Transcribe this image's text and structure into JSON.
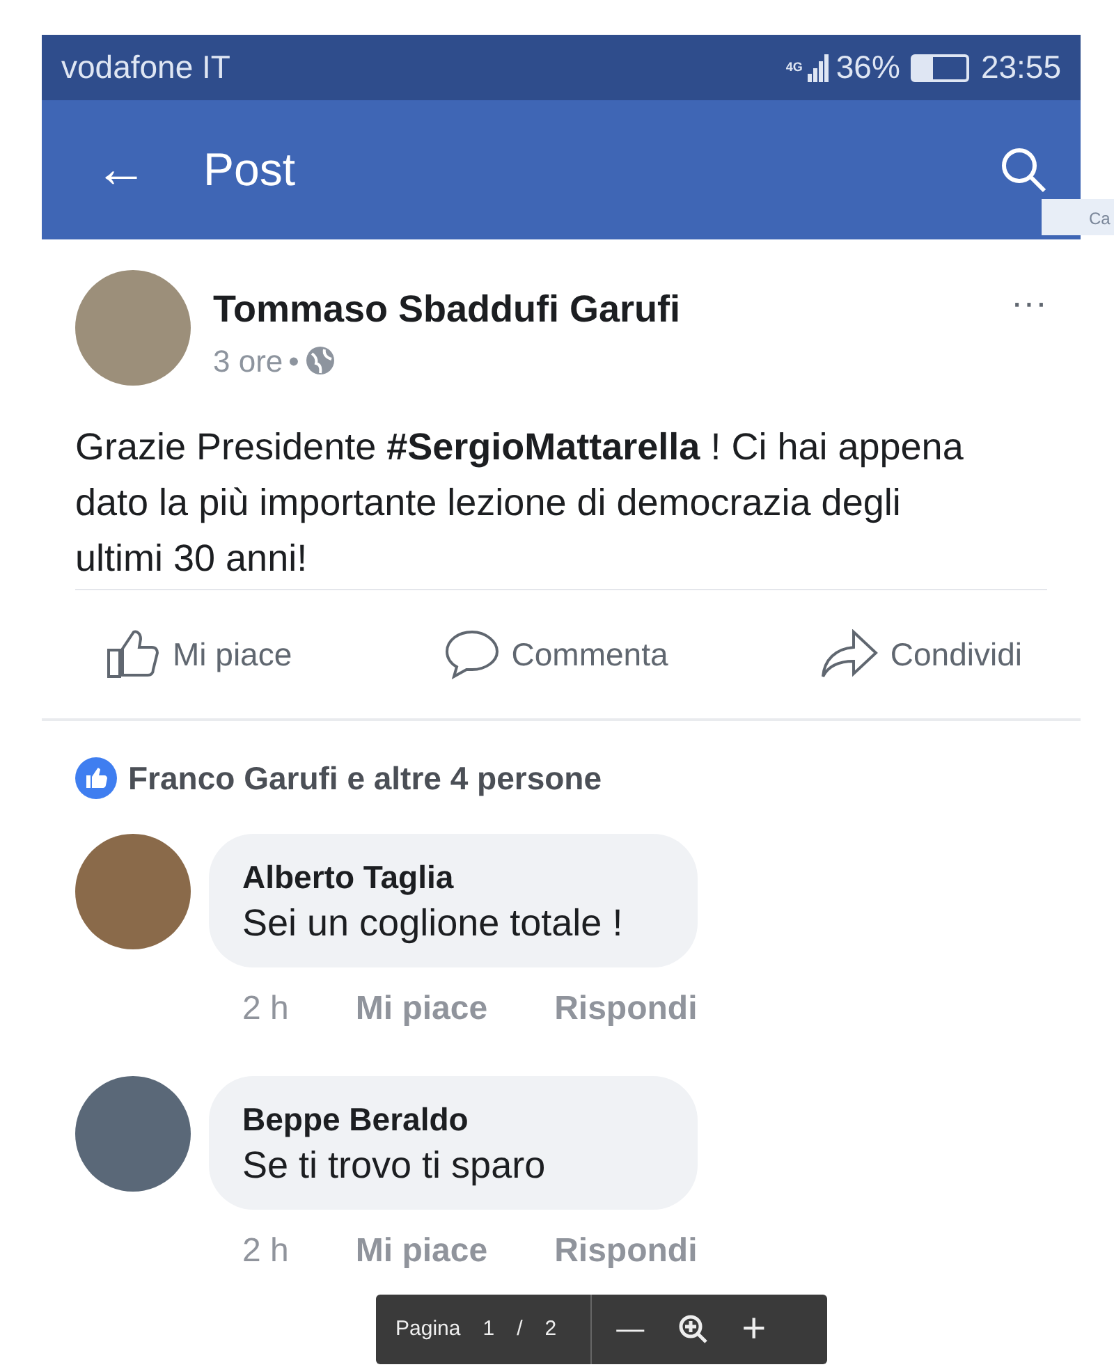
{
  "status_bar": {
    "carrier": "vodafone IT",
    "network": "4G",
    "battery_percent": "36%",
    "battery": {
      "level": 0.36
    },
    "time": "23:55"
  },
  "app_bar": {
    "back": "←",
    "title": "Post"
  },
  "side_fragment": "Ca",
  "post": {
    "author": "Tommaso Sbaddufi Garufi",
    "time": "3 ore",
    "separator": "•",
    "more": "···",
    "text": "Grazie Presidente **#SergioMattarella** ! Ci hai appena dato la più importante lezione di democrazia degli ultimi 30 anni!",
    "actions": [
      {
        "kind": "like",
        "label": "Mi piace"
      },
      {
        "kind": "comment",
        "label": "Commenta"
      },
      {
        "kind": "share",
        "label": "Condividi"
      }
    ],
    "reactions": "Franco Garufi e altre 4 persone"
  },
  "comments": [
    {
      "author": "Alberto Taglia",
      "text": "Sei un coglione totale !",
      "time": "2 h",
      "like": "Mi piace",
      "reply": "Rispondi"
    },
    {
      "author": "Beppe Beraldo",
      "text": "Se ti trovo ti sparo",
      "time": "2 h",
      "like": "Mi piace",
      "reply": "Rispondi"
    }
  ],
  "pdf_toolbar": {
    "label": "Pagina",
    "page": "1",
    "slash": "/",
    "total": "2",
    "zoom_out": "—",
    "zoom_in": "+"
  }
}
